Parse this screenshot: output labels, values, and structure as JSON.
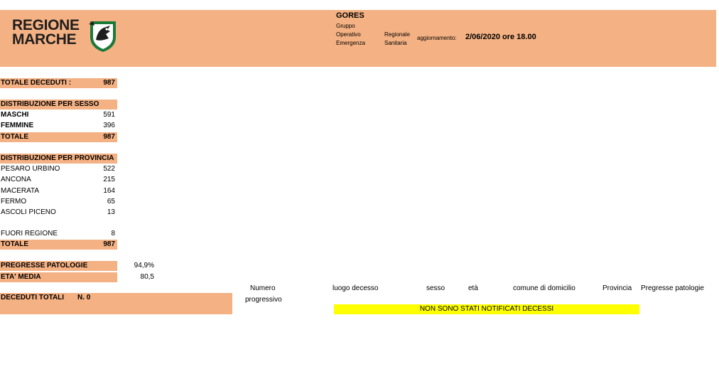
{
  "header": {
    "logo_line1": "REGIONE",
    "logo_line2": "MARCHE",
    "title": "GORES",
    "subtitle_col1": [
      "Gruppo",
      "Operativo",
      "Emergenza"
    ],
    "subtitle_col2": [
      "Regionale",
      "Sanitaria"
    ],
    "update_label": "aggiornamento:",
    "update_value": "2/06/2020 ore 18.00"
  },
  "totale_deceduti": {
    "label": "TOTALE DECEDUTI :",
    "value": "987"
  },
  "sesso": {
    "heading": "DISTRIBUZIONE PER SESSO",
    "rows": [
      {
        "label": "MASCHI",
        "value": "591"
      },
      {
        "label": "FEMMINE",
        "value": "396"
      },
      {
        "label": "TOTALE",
        "value": "987"
      }
    ]
  },
  "provincia": {
    "heading": "DISTRIBUZIONE PER PROVINCIA",
    "rows": [
      {
        "label": "PESARO URBINO",
        "value": "522"
      },
      {
        "label": "ANCONA",
        "value": "215"
      },
      {
        "label": "MACERATA",
        "value": "164"
      },
      {
        "label": "FERMO",
        "value": "65"
      },
      {
        "label": "ASCOLI PICENO",
        "value": "13"
      }
    ],
    "fuori": {
      "label": "FUORI REGIONE",
      "value": "8"
    },
    "totale": {
      "label": "TOTALE",
      "value": "987"
    }
  },
  "stats": {
    "patologie_label": "PREGRESSE PATOLOGIE",
    "patologie_value": "94,9%",
    "eta_label": "ETA' MEDIA",
    "eta_value": "80,5"
  },
  "deceduti_totali": {
    "label": "DECEDUTI TOTALI",
    "value": "N.  0"
  },
  "deaths_table": {
    "headers": {
      "numero_line1": "Numero",
      "numero_line2": "progressivo",
      "luogo": "luogo decesso",
      "sesso": "sesso",
      "eta": "età",
      "comune": "comune di domicilio",
      "provincia": "Provincia",
      "patologie": "Pregresse patologie"
    },
    "notice": "NON SONO STATI NOTIFICATI DECESSI"
  },
  "colors": {
    "band": "#f4b183",
    "notice": "#ffff00",
    "emblem_green": "#1a7a3a"
  }
}
